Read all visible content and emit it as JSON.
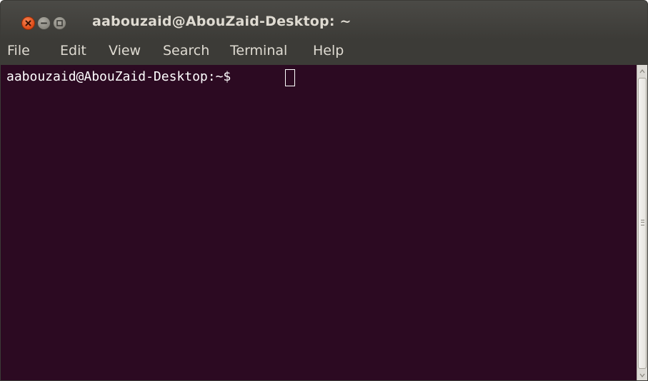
{
  "window": {
    "title": "aabouzaid@AbouZaid-Desktop: ~"
  },
  "titlebar_buttons": [
    {
      "name": "close",
      "icon": "close-icon",
      "color": "#e3501c"
    },
    {
      "name": "minimize",
      "icon": "minimize-icon",
      "color": "#8e8c84"
    },
    {
      "name": "maximize",
      "icon": "maximize-icon",
      "color": "#8e8c84"
    }
  ],
  "menu": {
    "items": [
      "File",
      "Edit",
      "View",
      "Search",
      "Terminal",
      "Help"
    ]
  },
  "terminal": {
    "prompt": "aabouzaid@AbouZaid-Desktop:~$ ",
    "background": "#2c0a22",
    "foreground": "#ffffff"
  },
  "colors": {
    "titlebar": "#3c3b37",
    "title_text": "#dfdbd2"
  }
}
